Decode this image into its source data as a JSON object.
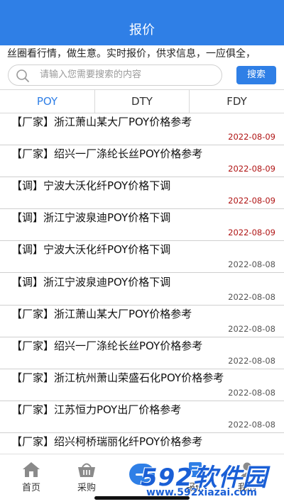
{
  "header": {
    "title": "报价"
  },
  "marquee": {
    "text": "丝圈看行情，做生意。实时报价，供求信息，一应俱全，"
  },
  "search": {
    "placeholder": "请输入您需要搜索的内容",
    "button_label": "搜索"
  },
  "tabs": [
    {
      "label": "POY",
      "active": true
    },
    {
      "label": "DTY",
      "active": false
    },
    {
      "label": "FDY",
      "active": false
    }
  ],
  "items": [
    {
      "title": "【厂家】浙江萧山某大厂POY价格参考",
      "date": "2022-08-09"
    },
    {
      "title": "【厂家】绍兴一厂涤纶长丝POY价格参考",
      "date": "2022-08-09"
    },
    {
      "title": "【调】宁波大沃化纤POY价格下调",
      "date": "2022-08-09"
    },
    {
      "title": "【调】浙江宁波泉迪POY价格下调",
      "date": "2022-08-09"
    },
    {
      "title": "【调】宁波大沃化纤POY价格下调",
      "date": "2022-08-08"
    },
    {
      "title": "【调】浙江宁波泉迪POY价格下调",
      "date": "2022-08-08"
    },
    {
      "title": "【厂家】浙江萧山某大厂POY价格参考",
      "date": "2022-08-08"
    },
    {
      "title": "【厂家】绍兴一厂涤纶长丝POY价格参考",
      "date": "2022-08-08"
    },
    {
      "title": "【厂家】浙江杭州萧山荣盛石化POY价格参考",
      "date": "2022-08-08"
    },
    {
      "title": "【厂家】江苏恒力POY出厂价格参考",
      "date": "2022-08-08"
    },
    {
      "title": "【厂家】绍兴柯桥瑞丽化纤POY价格参考",
      "date": ""
    }
  ],
  "tabbar": {
    "items": [
      {
        "label": "首页",
        "icon": "home-icon"
      },
      {
        "label": "采购",
        "icon": "basket-icon"
      },
      {
        "label": "报价",
        "icon": "quote-icon"
      },
      {
        "label": "我的",
        "icon": "user-icon"
      }
    ]
  },
  "watermark": {
    "brand": "592软件园",
    "url": "www.592xiazai.com"
  },
  "colors": {
    "brand_blue": "#2f7fe6",
    "recent_date_red": "#b01515",
    "old_date_gray": "#555555"
  }
}
